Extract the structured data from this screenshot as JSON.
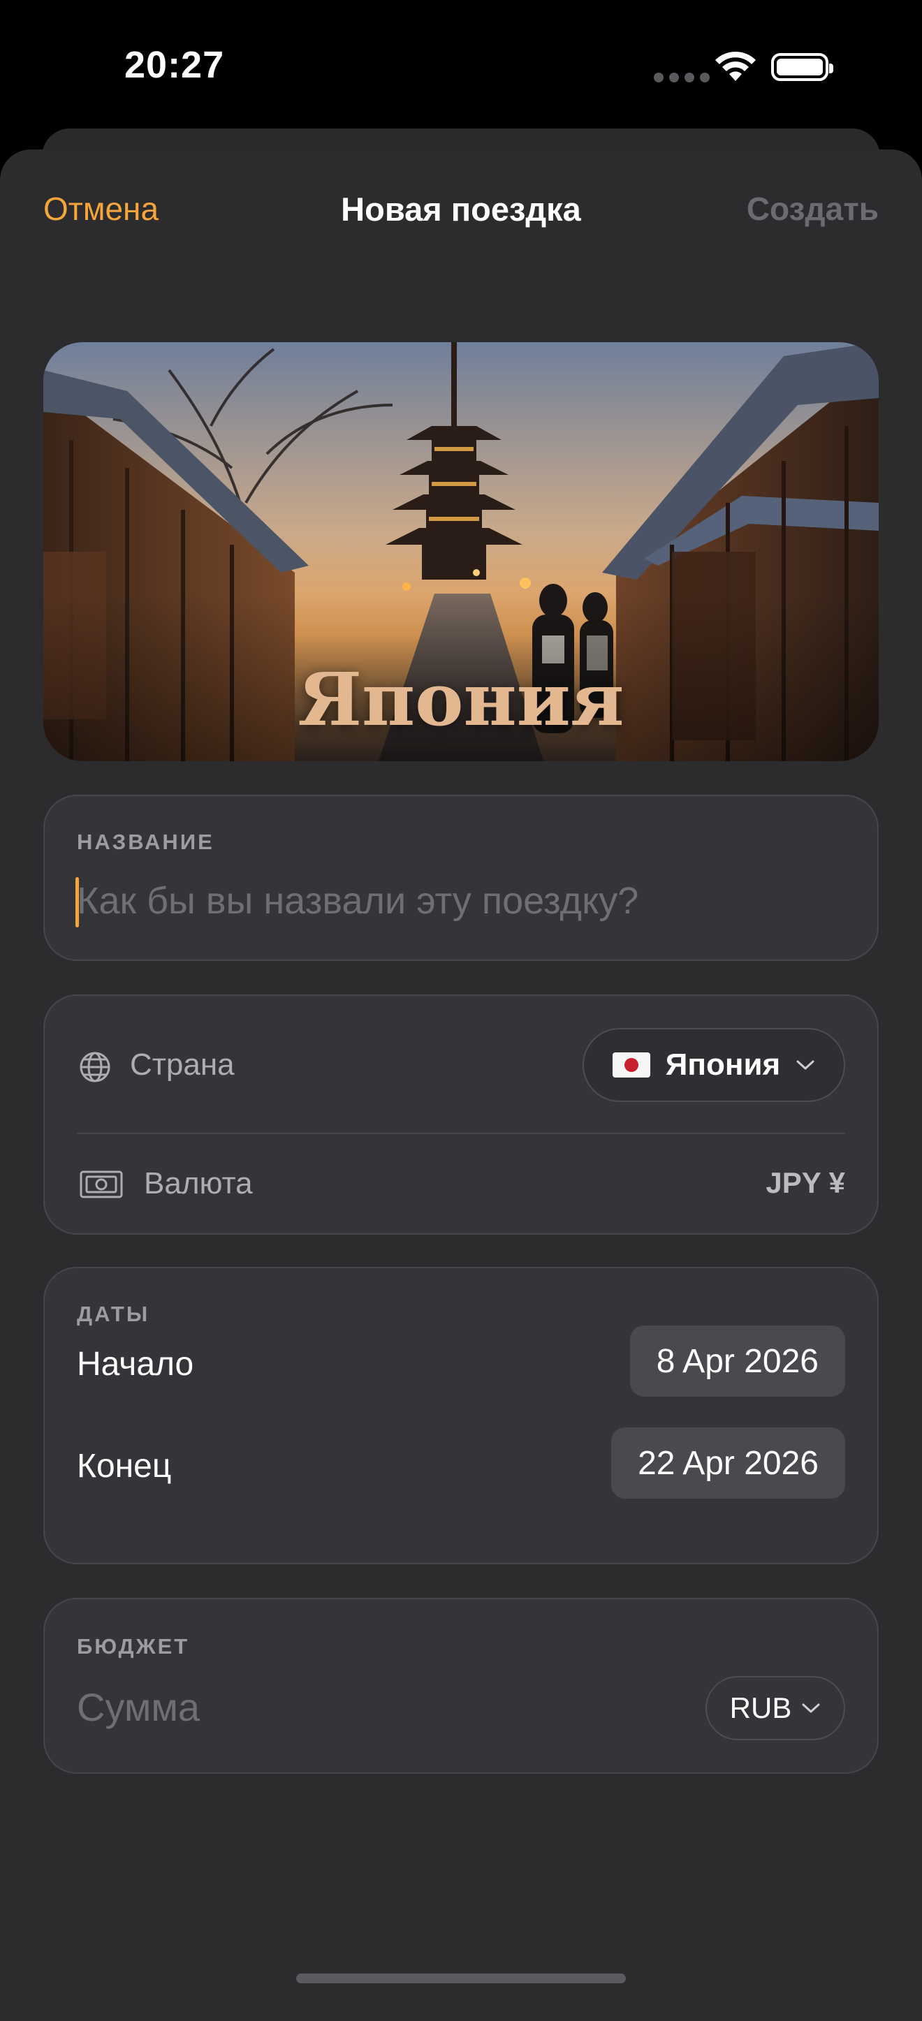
{
  "status_bar": {
    "time": "20:27"
  },
  "nav": {
    "cancel_label": "Отмена",
    "title": "Новая поездка",
    "create_label": "Создать"
  },
  "hero": {
    "destination_title": "Япония"
  },
  "name_section": {
    "label": "НАЗВАНИЕ",
    "value": "",
    "placeholder": "Как бы вы назвали эту поездку?"
  },
  "country_section": {
    "country_label": "Страна",
    "country_value": "Япония",
    "country_flag": "japan-flag",
    "currency_label": "Валюта",
    "currency_value": "JPY ¥"
  },
  "dates_section": {
    "label": "ДАТЫ",
    "start_label": "Начало",
    "start_value": "8 Apr 2026",
    "end_label": "Конец",
    "end_value": "22 Apr 2026"
  },
  "budget_section": {
    "label": "БЮДЖЕТ",
    "amount_value": "",
    "amount_placeholder": "Сумма",
    "currency_value": "RUB"
  },
  "colors": {
    "accent": "#f4a63a",
    "background": "#2c2b2e",
    "card": "#353438",
    "disabled_text": "#6c6b70"
  }
}
